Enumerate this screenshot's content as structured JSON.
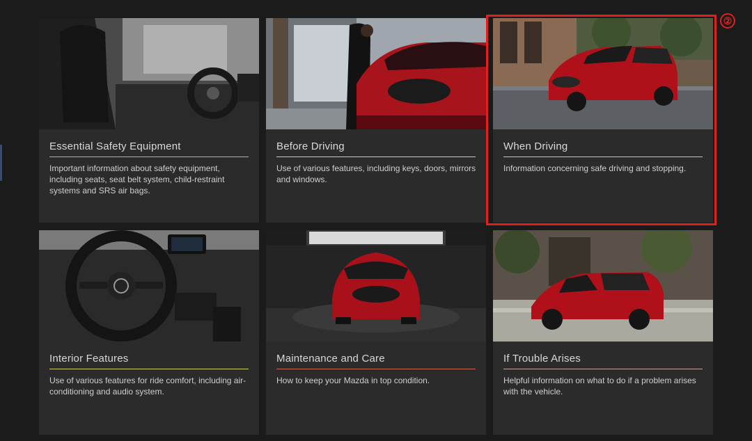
{
  "cards": [
    {
      "title": "Essential Safety Equipment",
      "description": "Important information about safety equipment, including seats, seat belt system, child-restraint systems and SRS air bags.",
      "image_icon": "car-interior-seats-photo",
      "accent_color": "#9fb7c9"
    },
    {
      "title": "Before Driving",
      "description": "Use of various features, including keys, doors, mirrors and windows.",
      "image_icon": "man-opening-red-suv-photo",
      "accent_color": "#c9c9c9"
    },
    {
      "title": "When Driving",
      "description": "Information concerning safe driving and stopping.",
      "image_icon": "red-suv-on-street-photo",
      "accent_color": "#cfc9a8"
    },
    {
      "title": "Interior Features",
      "description": "Use of various features for ride comfort, including air-conditioning and audio system.",
      "image_icon": "steering-wheel-dashboard-photo",
      "accent_color": "#d6cf6a"
    },
    {
      "title": "Maintenance and Care",
      "description": "How to keep your Mazda in top condition.",
      "image_icon": "red-suv-in-garage-photo",
      "accent_color": "#c96a4e"
    },
    {
      "title": "If Trouble Arises",
      "description": "Helpful information on what to do if a problem arises with the vehicle.",
      "image_icon": "red-suv-parked-by-building-photo",
      "accent_color": "#c9a0a0"
    }
  ],
  "annotation": {
    "badge_label": "②",
    "highlight_color": "#e0201f"
  }
}
